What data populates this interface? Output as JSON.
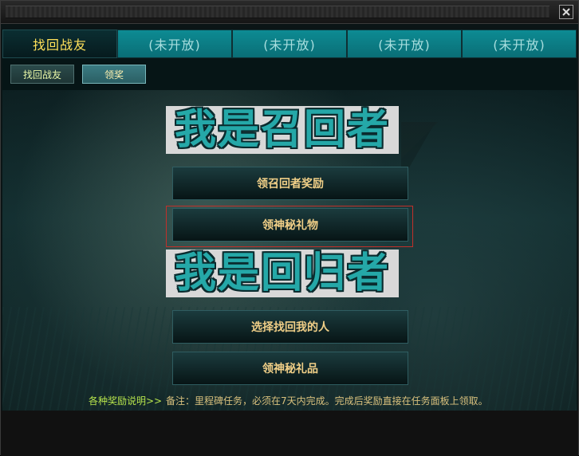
{
  "window": {
    "close_symbol": "✕"
  },
  "tabs": [
    {
      "label": "找回战友"
    },
    {
      "label": "(未开放)"
    },
    {
      "label": "(未开放)"
    },
    {
      "label": "(未开放)"
    },
    {
      "label": "(未开放)"
    }
  ],
  "subnav": {
    "find_label": "找回战友",
    "claim_label": "领奖"
  },
  "banners": {
    "recaller": "我是召回者",
    "returner": "我是回归者"
  },
  "actions": {
    "claim_recaller_reward": "领召回者奖励",
    "claim_mystery_gift": "领神秘礼物",
    "choose_recaller": "选择找回我的人",
    "claim_mystery_item": "领神秘礼品"
  },
  "footer": {
    "rules_link": "各种奖励说明>>",
    "note": "备注：里程碑任务，必须在7天内完成。完成后奖励直接在任务面板上领取。"
  }
}
